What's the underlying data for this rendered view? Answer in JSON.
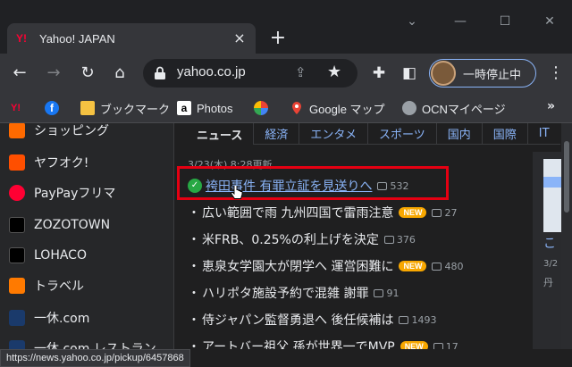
{
  "browser": {
    "tab": {
      "title": "Yahoo! JAPAN",
      "favicon": "Y!"
    },
    "newtab_glyph": "+",
    "toolbar": {
      "url": "yahoo.co.jp",
      "profile_label": "一時停止中"
    },
    "bookmarks": [
      {
        "label": "",
        "icon": "yahoo-icon"
      },
      {
        "label": "",
        "icon": "facebook-icon"
      },
      {
        "label": "ブックマーク",
        "icon": "folder-icon"
      },
      {
        "label": "Photos",
        "icon": "amazon-icon"
      },
      {
        "label": "",
        "icon": "pinwheel-icon"
      },
      {
        "label": "Google マップ",
        "icon": "maps-pin-icon"
      },
      {
        "label": "OCNマイページ",
        "icon": "globe-icon"
      }
    ]
  },
  "sidebar": {
    "items": [
      {
        "label": "ショッピング",
        "color": "#ff6a00"
      },
      {
        "label": "ヤフオク!",
        "color": "#ff4f00"
      },
      {
        "label": "PayPayフリマ",
        "color": "#ff0033"
      },
      {
        "label": "ZOZOTOWN",
        "color": "#000000"
      },
      {
        "label": "LOHACO",
        "color": "#000000"
      },
      {
        "label": "トラベル",
        "color": "#ff7a00"
      },
      {
        "label": "一休.com",
        "color": "#1a3a6b"
      },
      {
        "label": "一休.com レストラン",
        "color": "#1a3a6b"
      }
    ]
  },
  "news": {
    "tabs": [
      "ニュース",
      "経済",
      "エンタメ",
      "スポーツ",
      "国内",
      "国際",
      "IT"
    ],
    "updated": "3/23(木) 8:28更新",
    "items": [
      {
        "headline": "袴田事件 有罪立証を見送りへ",
        "comments": "532",
        "new": false,
        "highlighted": true
      },
      {
        "headline": "広い範囲で雨 九州四国で雷雨注意",
        "comments": "27",
        "new": true
      },
      {
        "headline": "米FRB、0.25%の利上げを決定",
        "comments": "376",
        "new": false
      },
      {
        "headline": "恵泉女学園大が閉学へ 運営困難に",
        "comments": "480",
        "new": true
      },
      {
        "headline": "ハリポタ施設予約で混雑 謝罪",
        "comments": "91",
        "new": false
      },
      {
        "headline": "侍ジャパン監督勇退へ 後任候補は",
        "comments": "1493",
        "new": false
      },
      {
        "headline": "アートバー祖父 孫が世界一でMVP",
        "comments": "17",
        "new": true
      }
    ],
    "new_label": "NEW",
    "right_col": {
      "line1": "こ",
      "line2": "3/2",
      "line3": "丹"
    }
  },
  "statusbar": {
    "url": "https://news.yahoo.co.jp/pickup/6457868"
  }
}
